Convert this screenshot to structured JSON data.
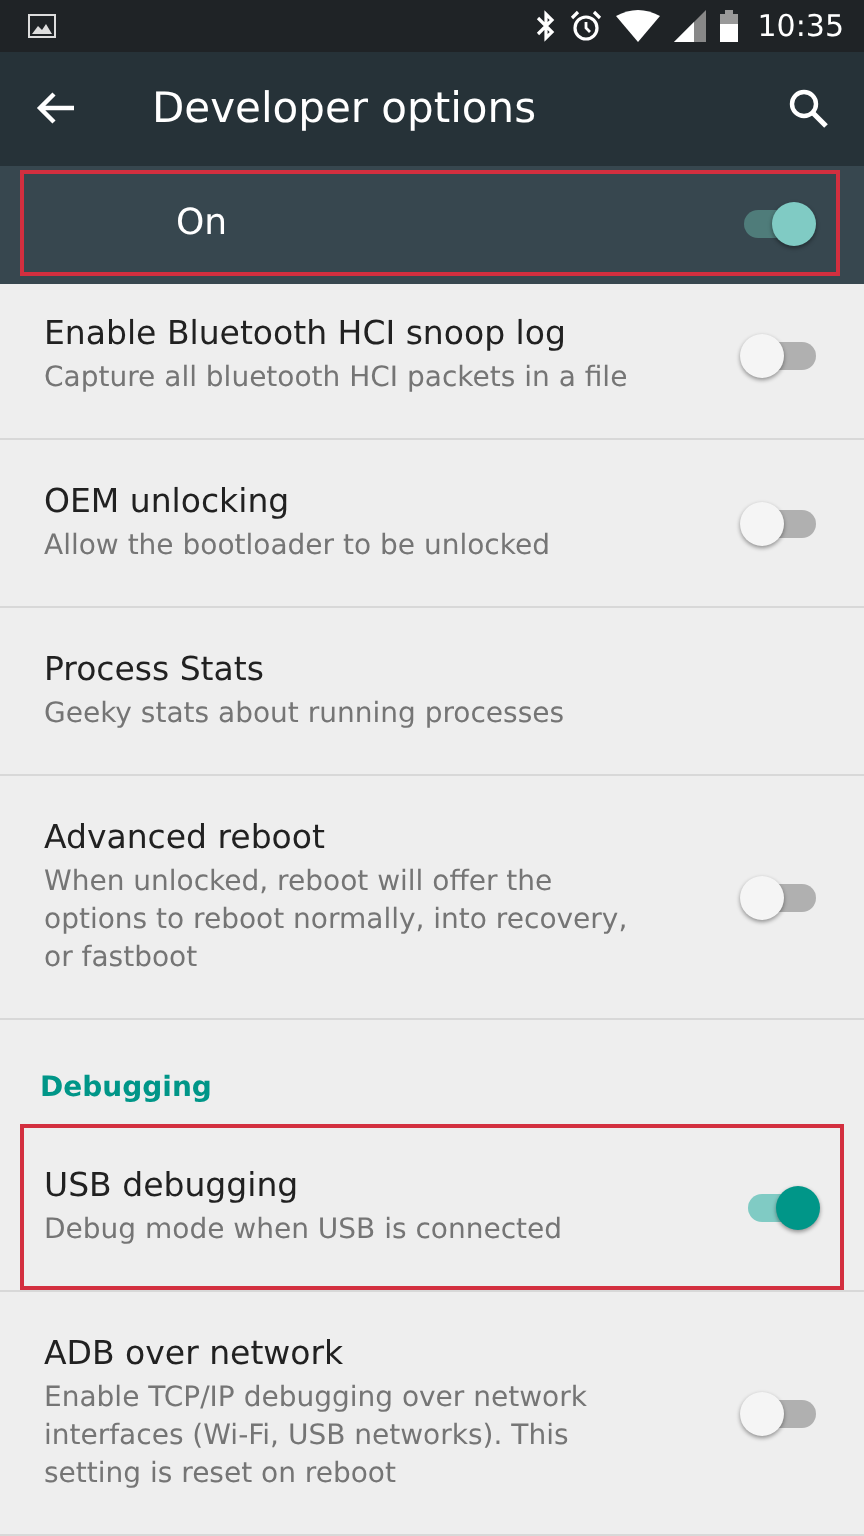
{
  "status_bar": {
    "time": "10:35"
  },
  "toolbar": {
    "title": "Developer options"
  },
  "master_switch": {
    "label": "On",
    "on": true,
    "highlighted": true
  },
  "settings": [
    {
      "kind": "switch",
      "title": "Enable Bluetooth HCI snoop log",
      "summary": "Capture all bluetooth HCI packets in a file",
      "on": false,
      "highlighted": false
    },
    {
      "kind": "switch",
      "title": "OEM unlocking",
      "summary": "Allow the bootloader to be unlocked",
      "on": false,
      "highlighted": false
    },
    {
      "kind": "plain",
      "title": "Process Stats",
      "summary": "Geeky stats about running processes"
    },
    {
      "kind": "switch",
      "title": "Advanced reboot",
      "summary": "When unlocked, reboot will offer the options to reboot normally, into recovery, or fastboot",
      "on": false,
      "highlighted": false
    },
    {
      "kind": "header",
      "title": "Debugging"
    },
    {
      "kind": "switch",
      "title": "USB debugging",
      "summary": "Debug mode when USB is connected",
      "on": true,
      "highlighted": true
    },
    {
      "kind": "switch",
      "title": "ADB over network",
      "summary": "Enable TCP/IP debugging over network interfaces (Wi-Fi, USB networks). This setting is reset on reboot",
      "on": false,
      "highlighted": false
    }
  ]
}
